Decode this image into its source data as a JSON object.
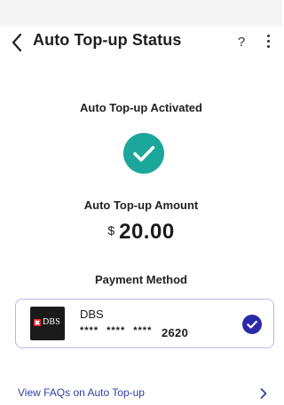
{
  "header": {
    "back_icon": "chevron-left-icon",
    "title": "Auto Top-up Status",
    "help_label": "?",
    "more_icon": "more-vertical-icon"
  },
  "status": {
    "label": "Auto Top-up Activated",
    "icon": "check-circle-icon",
    "color": "#1ba79a"
  },
  "amount": {
    "label": "Auto Top-up Amount",
    "currency": "$",
    "value": "20.00"
  },
  "payment": {
    "label": "Payment Method",
    "card": {
      "logo_text": "DBS",
      "bank_name": "DBS",
      "masked_groups": [
        "****",
        "****",
        "****"
      ],
      "last4": "2620",
      "selected": true,
      "border_color": "#b7b6e8",
      "check_color": "#2a2aa8"
    }
  },
  "faq": {
    "link_text": "View FAQs on Auto Top-up",
    "icon": "chevron-right-icon",
    "color": "#2c3fa0"
  }
}
